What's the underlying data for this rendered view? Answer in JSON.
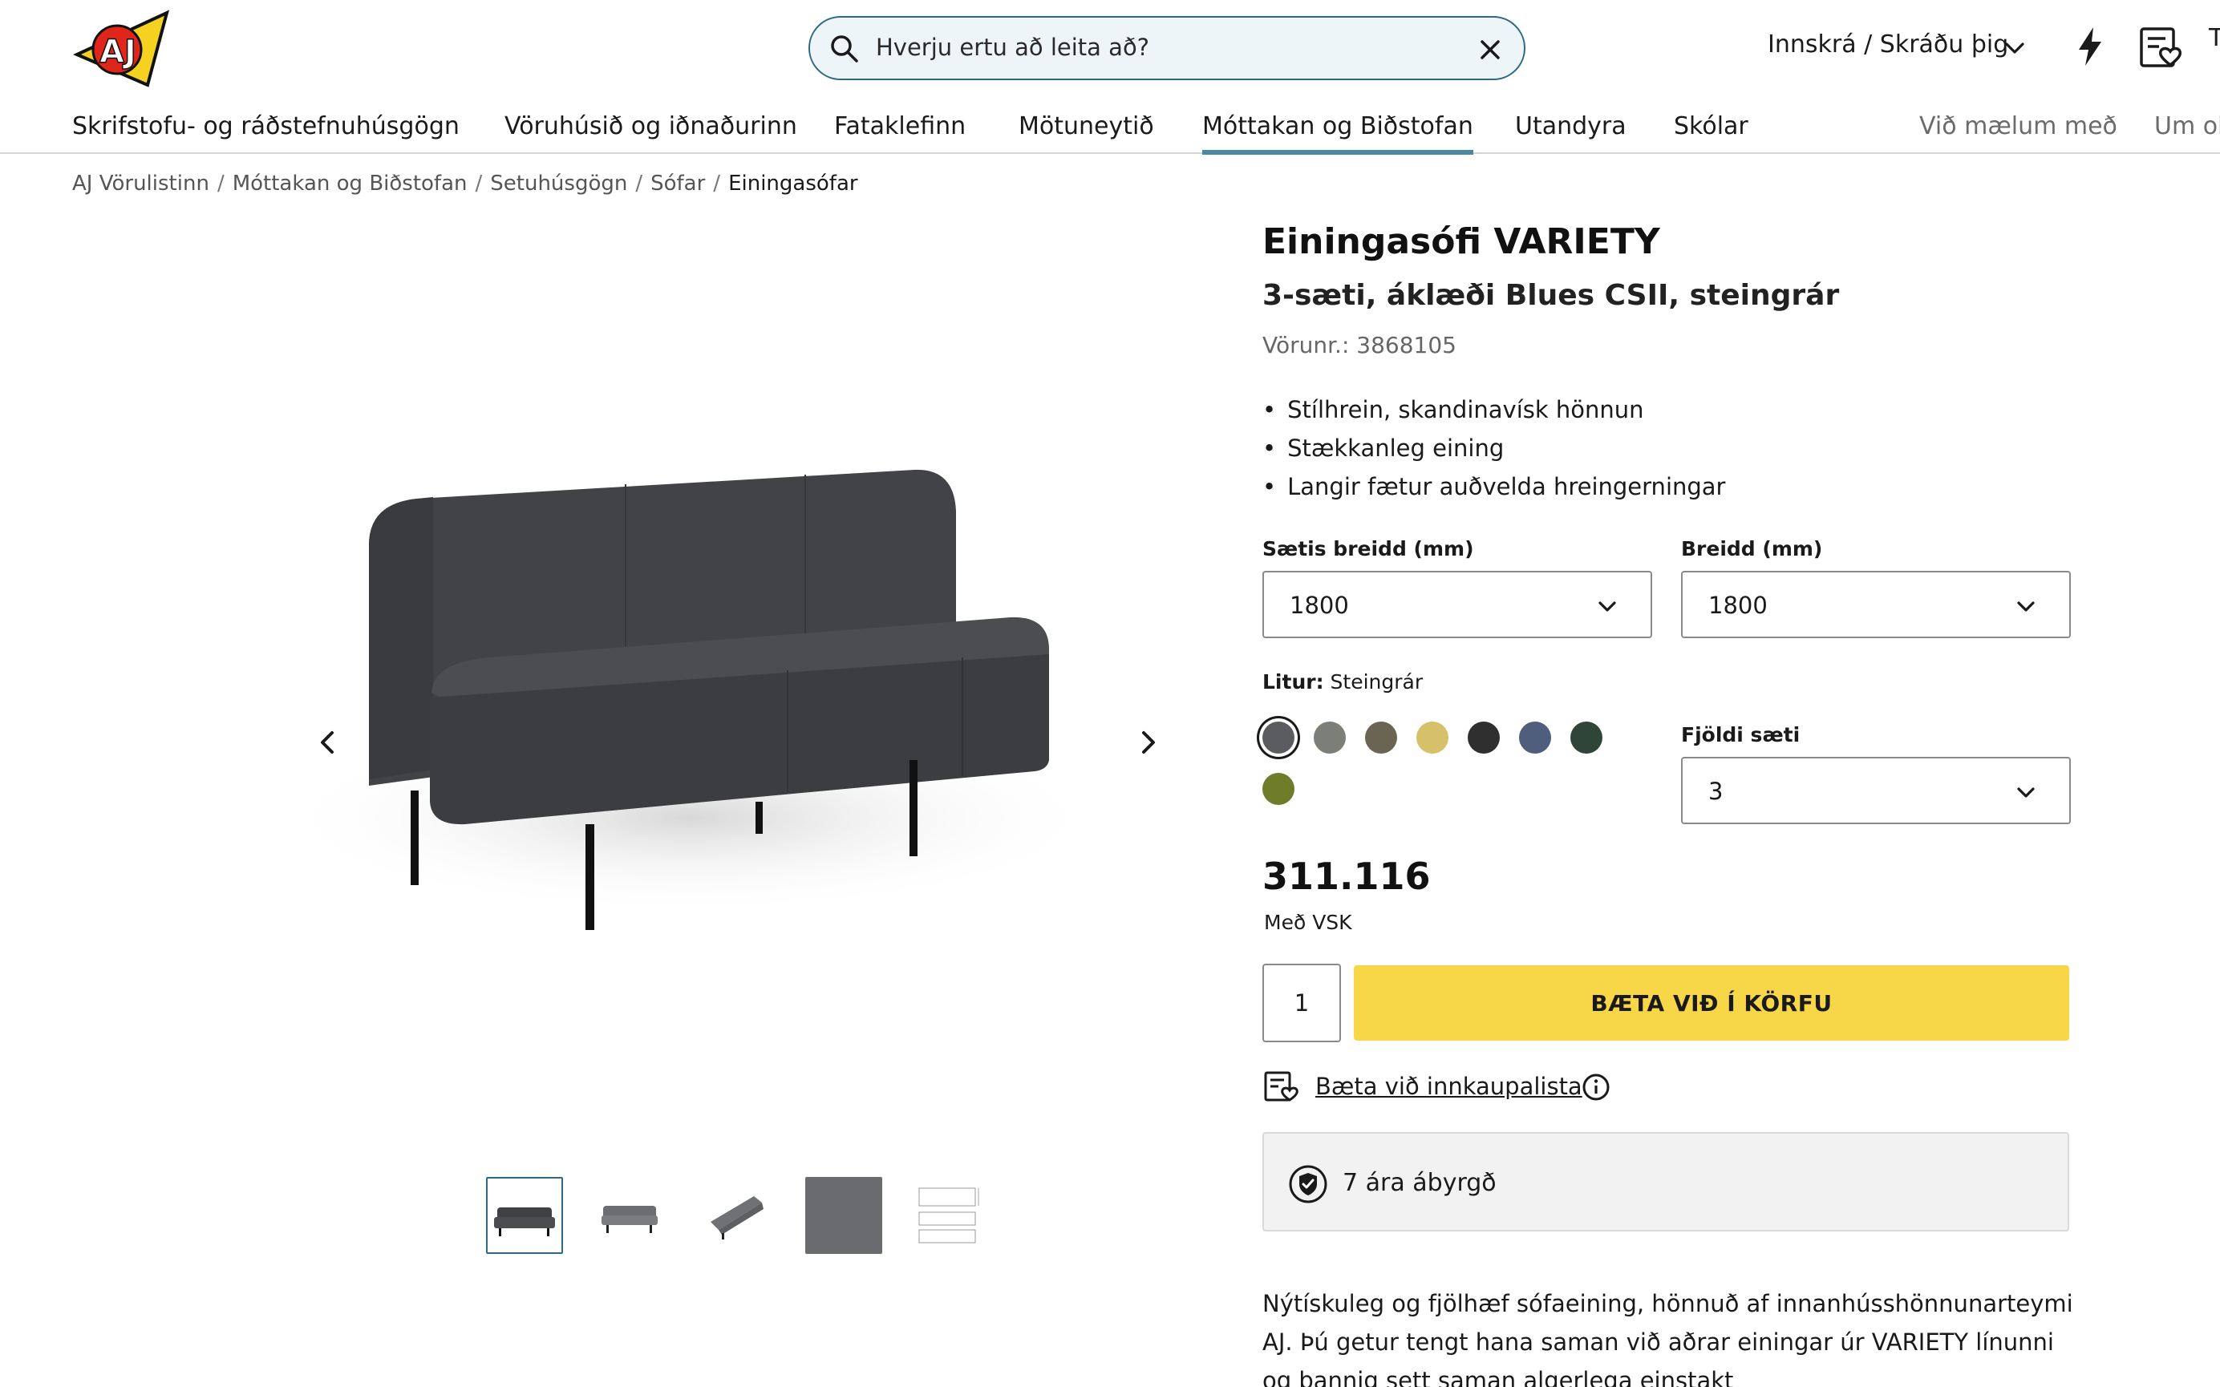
{
  "header": {
    "logo_text": "AJ",
    "search": {
      "placeholder": "Hverju ertu að leita að?"
    },
    "login_label": "Innskrá / Skráðu þig",
    "edge_letter": "T"
  },
  "nav": {
    "items": [
      "Skrifstofu- og ráðstefnuhúsgögn",
      "Vöruhúsið og iðnaðurinn",
      "Fataklefinn",
      "Mötuneytið",
      "Móttakan og Biðstofan",
      "Utandyra",
      "Skólar"
    ],
    "active_item": "Móttakan og Biðstofan",
    "secondary": [
      "Við mælum með",
      "Um ok"
    ]
  },
  "breadcrumb": [
    "AJ Vörulistinn",
    "Móttakan og Biðstofan",
    "Setuhúsgögn",
    "Sófar",
    "Einingasófar"
  ],
  "product": {
    "title": "Einingasófi VARIETY",
    "subtitle": "3-sæti, áklæði Blues CSII, steingrár",
    "sku": "Vörunr.: 3868105",
    "features": [
      "Stílhrein, skandinavísk hönnun",
      "Stækkanleg eining",
      "Langir fætur auðvelda hreingerningar"
    ],
    "seat_width_label": "Sætis breidd (mm)",
    "seat_width_value": "1800",
    "width_label": "Breidd (mm)",
    "width_value": "1800",
    "color_label_key": "Litur:",
    "color_label_value": "Steingrár",
    "colors": [
      "#5b5c60",
      "#7c7f78",
      "#6a6453",
      "#d7c06a",
      "#2f2f2f",
      "#4f5e7c",
      "#2f4538",
      "#6f7d2a"
    ],
    "selected_color": 0,
    "seats_label": "Fjöldi sæti",
    "seats_value": "3",
    "price": "311.116",
    "vat_label": "Með VSK",
    "quantity": "1",
    "add_to_cart_label": "BÆTA VIÐ Í KÖRFU",
    "wishlist_label": "Bæta við innkaupalista",
    "warranty_label": "7 ára ábyrgð",
    "description": "Nýtískuleg og fjölhæf sófaeining, hönnuð af innanhússhönnunarteymi AJ. Þú getur tengt hana saman við aðrar einingar úr VARIETY línunni og þannig sett saman algerlega einstakt"
  },
  "gallery": {
    "thumbnails": [
      "sofa-front",
      "sofa-side",
      "sofa-angle",
      "fabric-swatch",
      "dimension-drawing"
    ],
    "selected": 0
  }
}
